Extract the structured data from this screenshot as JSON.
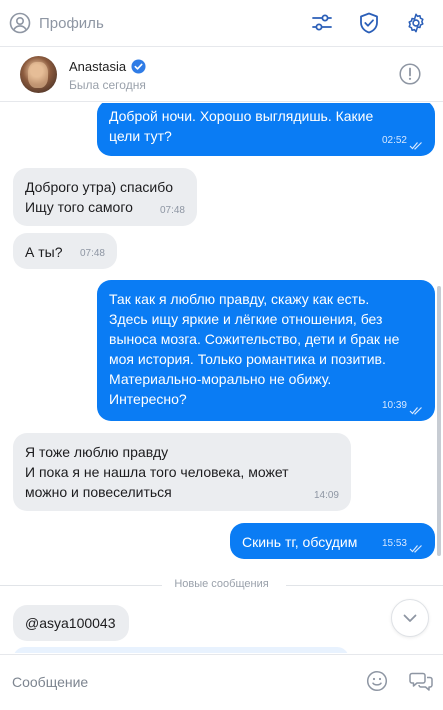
{
  "topbar": {
    "profile_label": "Профиль",
    "icons": [
      "user-circle-icon",
      "sliders-icon",
      "shield-check-icon",
      "gear-icon"
    ]
  },
  "chat_header": {
    "name": "Anastasia",
    "verified": true,
    "status": "Была сегодня",
    "warn_icon": "exclamation-circle-icon"
  },
  "messages": [
    {
      "direction": "out",
      "text": "Доброй ночи. Хорошо выглядишь. Какие\nцели тут?",
      "time": "02:52",
      "read": true
    },
    {
      "direction": "in",
      "text": "Доброго утра) спасибо\nИщу того самого",
      "time": "07:48"
    },
    {
      "direction": "in",
      "text": "А ты?",
      "time": "07:48"
    },
    {
      "direction": "out",
      "text": "Так как я люблю правду, скажу как есть.\nЗдесь ищу яркие и лёгкие отношения, без\nвыноса мозга. Сожительство, дети и брак не\nмоя история. Только романтика и позитив.\nМатериально-морально не обижу.\nИнтересно?",
      "time": "10:39",
      "read": true
    },
    {
      "direction": "in",
      "text": "Я тоже люблю правду\nИ пока я не нашла того человека, может\nможно и повеселиться",
      "time": "14:09"
    },
    {
      "direction": "out",
      "text": "Скинь тг, обсудим",
      "time": "15:53",
      "read": true
    }
  ],
  "new_messages_label": "Новые сообщения",
  "new_messages": [
    {
      "direction": "in",
      "text": "@asya100043"
    }
  ],
  "input": {
    "placeholder": "Сообщение",
    "value": ""
  },
  "colors": {
    "outgoing_bubble": "#0a7cf4",
    "incoming_bubble": "#ebedf0",
    "icon_blue": "#2b5fb8",
    "verified_badge": "#2f7ce6"
  }
}
